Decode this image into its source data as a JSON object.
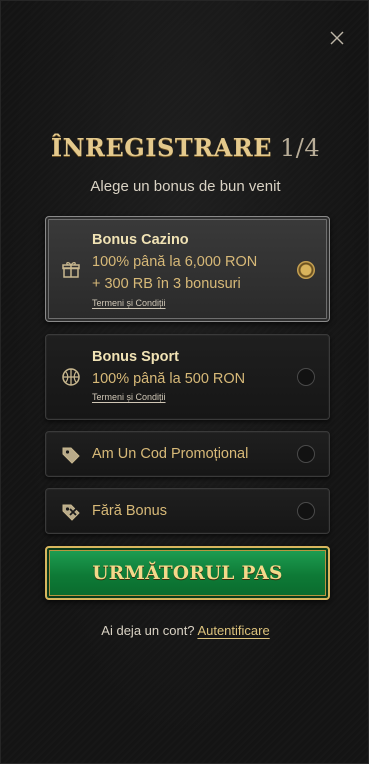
{
  "header": {
    "title": "ÎNREGISTRARE",
    "step": "1/4",
    "subtitle": "Alege un bonus de bun venit"
  },
  "options": [
    {
      "title": "Bonus Cazino",
      "desc_line1": "100% până la 6,000 RON",
      "desc_line2": "+ 300 RB în 3 bonusuri",
      "terms": "Termeni și Condiții",
      "icon": "gift-icon",
      "selected": true
    },
    {
      "title": "Bonus Sport",
      "desc_line1": "100% până la 500 RON",
      "terms": "Termeni și Condiții",
      "icon": "basketball-icon",
      "selected": false
    },
    {
      "label": "Am Un Cod Promoțional",
      "icon": "tag-icon",
      "selected": false
    },
    {
      "label": "Fără Bonus",
      "icon": "no-tag-icon",
      "selected": false
    }
  ],
  "actions": {
    "next_label": "URMĂTORUL PAS"
  },
  "footer": {
    "question": "Ai deja un cont?",
    "login_label": "Autentificare"
  },
  "colors": {
    "accent_gold": "#d8b65e",
    "cta_green": "#0e7a36",
    "background": "#141414"
  }
}
